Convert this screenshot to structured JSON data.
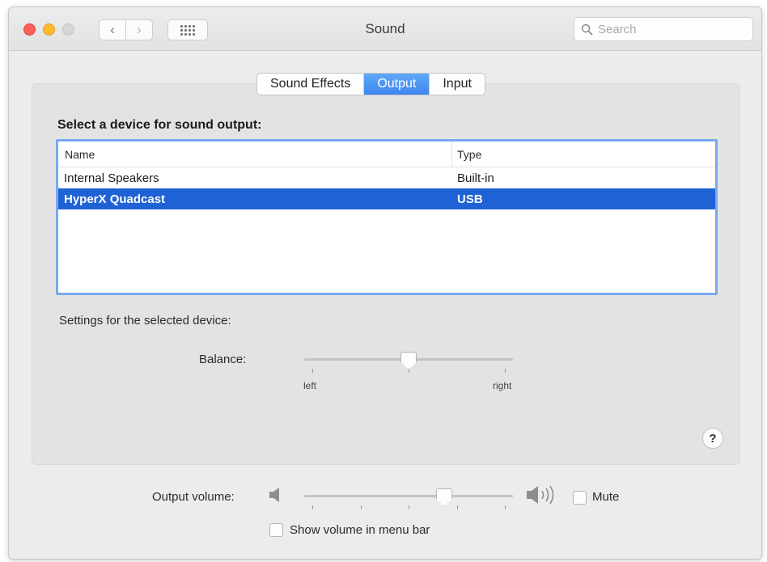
{
  "window": {
    "title": "Sound",
    "search_placeholder": "Search"
  },
  "nav": {
    "back_glyph": "‹",
    "forward_glyph": "›"
  },
  "tabs": [
    {
      "label": "Sound Effects",
      "active": false
    },
    {
      "label": "Output",
      "active": true
    },
    {
      "label": "Input",
      "active": false
    }
  ],
  "output": {
    "section_label": "Select a device for sound output:",
    "columns": [
      "Name",
      "Type"
    ],
    "devices": [
      {
        "name": "Internal Speakers",
        "type": "Built-in",
        "selected": false
      },
      {
        "name": "HyperX Quadcast",
        "type": "USB",
        "selected": true
      }
    ],
    "settings_label": "Settings for the selected device:",
    "balance": {
      "label": "Balance:",
      "left_label": "left",
      "right_label": "right",
      "value": 0.5
    },
    "help_label": "?"
  },
  "volume": {
    "label": "Output volume:",
    "level": 0.67,
    "mute_label": "Mute",
    "mute_checked": false,
    "show_in_menu_label": "Show volume in menu bar",
    "show_in_menu_checked": false
  },
  "colors": {
    "accent": "#1f62d6",
    "table_focus_ring": "#78a9ee",
    "close": "#fc5f57",
    "minimize": "#fdbc2e"
  },
  "icons": [
    "search-icon",
    "back-chevron-icon",
    "forward-chevron-icon",
    "show-all-grid-icon",
    "speaker-low-icon",
    "speaker-high-icon"
  ]
}
